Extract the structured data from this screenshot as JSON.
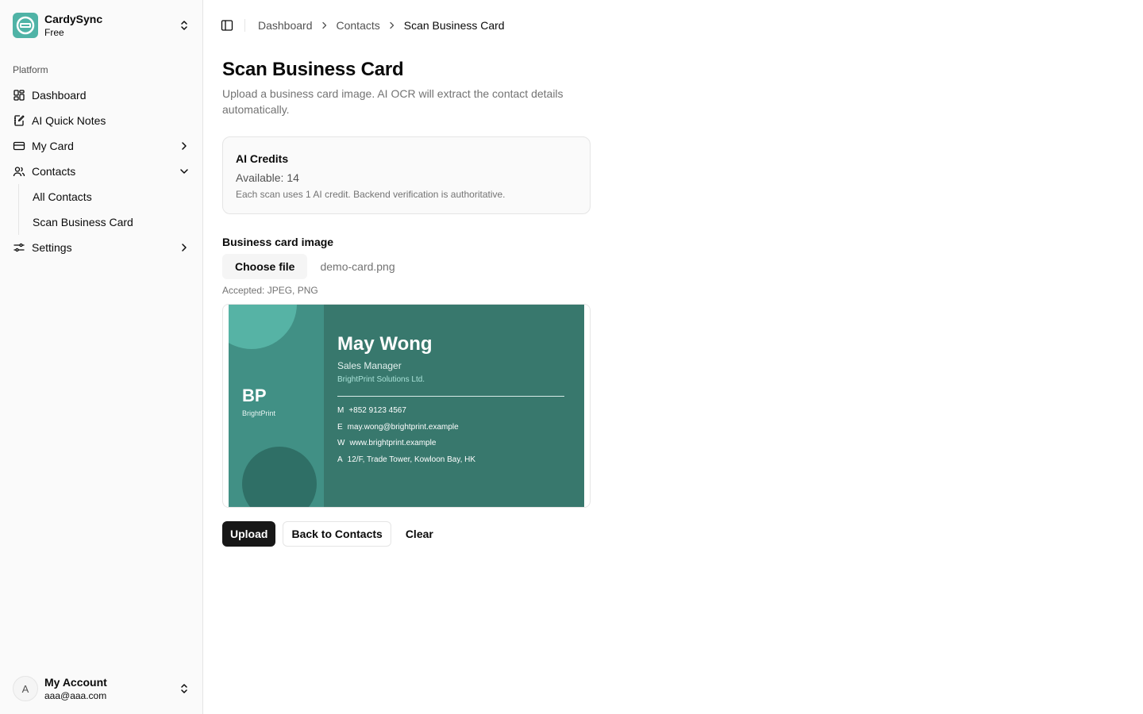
{
  "brand": {
    "name": "CardySync",
    "plan": "Free",
    "color": "#4fb3a6"
  },
  "sidebar": {
    "group_label": "Platform",
    "items": [
      {
        "label": "Dashboard",
        "icon": "dashboard-icon"
      },
      {
        "label": "AI Quick Notes",
        "icon": "notebook-pen-icon"
      },
      {
        "label": "My Card",
        "icon": "credit-card-icon",
        "expandable": true
      },
      {
        "label": "Contacts",
        "icon": "users-icon",
        "expanded": true,
        "children": [
          {
            "label": "All Contacts"
          },
          {
            "label": "Scan Business Card"
          }
        ]
      },
      {
        "label": "Settings",
        "icon": "settings-sliders-icon",
        "expandable": true
      }
    ]
  },
  "account": {
    "initial": "A",
    "name": "My Account",
    "email": "aaa@aaa.com"
  },
  "breadcrumb": [
    "Dashboard",
    "Contacts",
    "Scan Business Card"
  ],
  "page": {
    "title": "Scan Business Card",
    "description": "Upload a business card image. AI OCR will extract the contact details automatically."
  },
  "credits": {
    "title": "AI Credits",
    "available": "Available: 14",
    "note": "Each scan uses 1 AI credit. Backend verification is authoritative."
  },
  "upload": {
    "label": "Business card image",
    "choose_label": "Choose file",
    "file_name": "demo-card.png",
    "hint": "Accepted: JPEG, PNG"
  },
  "card_preview": {
    "logo": "BP",
    "logo_sub": "BrightPrint",
    "name": "May Wong",
    "role": "Sales Manager",
    "company": "BrightPrint Solutions Ltd.",
    "rows": [
      {
        "key": "M",
        "value": "+852 9123 4567"
      },
      {
        "key": "E",
        "value": "may.wong@brightprint.example"
      },
      {
        "key": "W",
        "value": "www.brightprint.example"
      },
      {
        "key": "A",
        "value": "12/F, Trade Tower, Kowloon Bay, HK"
      }
    ],
    "colors": {
      "primary": "#38786d",
      "accent": "#56b3a5"
    }
  },
  "actions": {
    "upload": "Upload",
    "back": "Back to Contacts",
    "clear": "Clear"
  }
}
